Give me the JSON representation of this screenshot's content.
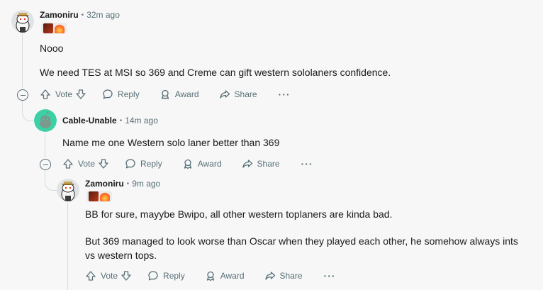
{
  "comments": [
    {
      "author": "Zamoniru",
      "separator": "•",
      "time": "32m ago",
      "flair": [
        "champion-icon",
        "fire-icon"
      ],
      "paragraphs": [
        "Nooo",
        "We need TES at MSI so 369 and Creme can gift western sololaners confidence."
      ]
    },
    {
      "author": "Cable-Unable",
      "separator": "•",
      "time": "14m ago",
      "paragraphs": [
        "Name me one Western solo laner better than 369"
      ]
    },
    {
      "author": "Zamoniru",
      "separator": "•",
      "time": "9m ago",
      "flair": [
        "champion-icon",
        "fire-icon"
      ],
      "paragraphs": [
        "BB for sure, mayybe Bwipo, all other western toplaners are kinda bad.",
        "But 369 managed to look worse than Oscar when they played each other, he somehow always ints",
        "vs western tops."
      ]
    }
  ],
  "actions": {
    "vote": "Vote",
    "reply": "Reply",
    "award": "Award",
    "share": "Share",
    "more": "···"
  },
  "colors": {
    "background": "#f7f7f7",
    "thread_line": "#d7dadc",
    "meta_text": "#576f76",
    "avatar_green": "#3bd1a5"
  }
}
